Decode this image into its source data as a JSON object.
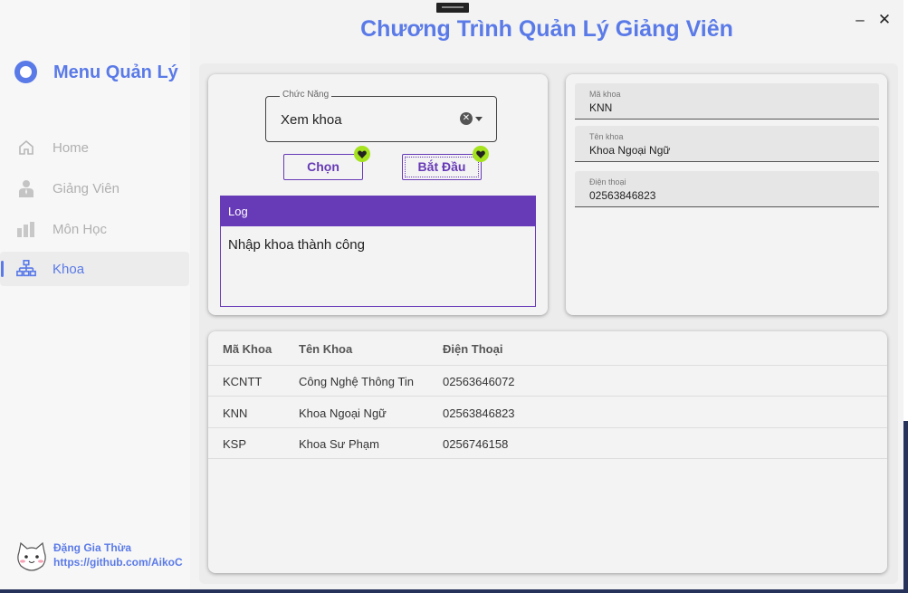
{
  "app": {
    "title": "Chương Trình Quản Lý Giảng Viên",
    "minimize": "–",
    "close": "✕"
  },
  "colors": {
    "accent": "#5a7ae8",
    "purple": "#673ab7",
    "badge": "#a4e31d"
  },
  "sidebar": {
    "title": "Menu Quản Lý",
    "items": [
      {
        "label": "Home",
        "icon": "home-icon",
        "active": false
      },
      {
        "label": "Giảng Viên",
        "icon": "teacher-icon",
        "active": false
      },
      {
        "label": "Môn Học",
        "icon": "subject-icon",
        "active": false
      },
      {
        "label": "Khoa",
        "icon": "org-chart-icon",
        "active": true
      }
    ],
    "author": {
      "name": "Đặng Gia Thừa",
      "link": "https://github.com/AikoC"
    }
  },
  "function_panel": {
    "select_label": "Chức Năng",
    "select_value": "Xem khoa",
    "choose_button": "Chọn",
    "start_button": "Bắt Đầu",
    "log_title": "Log",
    "log_text": "Nhập khoa thành công"
  },
  "detail_panel": {
    "fields": [
      {
        "label": "Mã khoa",
        "value": "KNN"
      },
      {
        "label": "Tên khoa",
        "value": "Khoa Ngoại Ngữ"
      },
      {
        "label": "Điện thoại",
        "value": "02563846823"
      }
    ]
  },
  "table": {
    "columns": [
      "Mã Khoa",
      "Tên Khoa",
      "Điện Thoại"
    ],
    "rows": [
      [
        "KCNTT",
        "Công Nghệ Thông Tin",
        "02563646072"
      ],
      [
        "KNN",
        "Khoa Ngoại Ngữ",
        "02563846823"
      ],
      [
        "KSP",
        "Khoa Sư Phạm",
        "0256746158"
      ]
    ]
  }
}
